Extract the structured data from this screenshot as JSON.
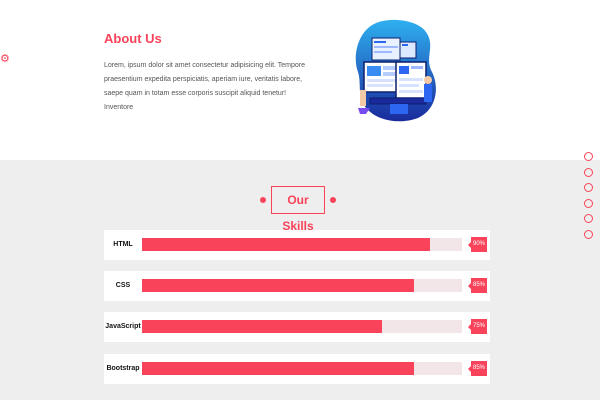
{
  "about": {
    "title": "About Us",
    "text": "Lorem, ipsum dolor sit amet consectetur adipisicing elit. Tempore praesentium expedita perspiciatis, aperiam iure, veritatis labore, saepe quam in totam esse corporis suscipit aliquid tenetur! Inventore",
    "icon": "gear-icon",
    "illustration": "web-development-illustration"
  },
  "skills": {
    "title": "Our Skills",
    "items": [
      {
        "name": "HTML",
        "percent": 90,
        "label": "90%"
      },
      {
        "name": "CSS",
        "percent": 85,
        "label": "85%"
      },
      {
        "name": "JavaScript",
        "percent": 75,
        "label": "75%"
      },
      {
        "name": "Bootstrap",
        "percent": 85,
        "label": "85%"
      }
    ]
  },
  "side_nav": {
    "count": 6
  },
  "colors": {
    "accent": "#f9435a",
    "track": "#f3e6e8",
    "section_bg": "#eeeeee"
  }
}
